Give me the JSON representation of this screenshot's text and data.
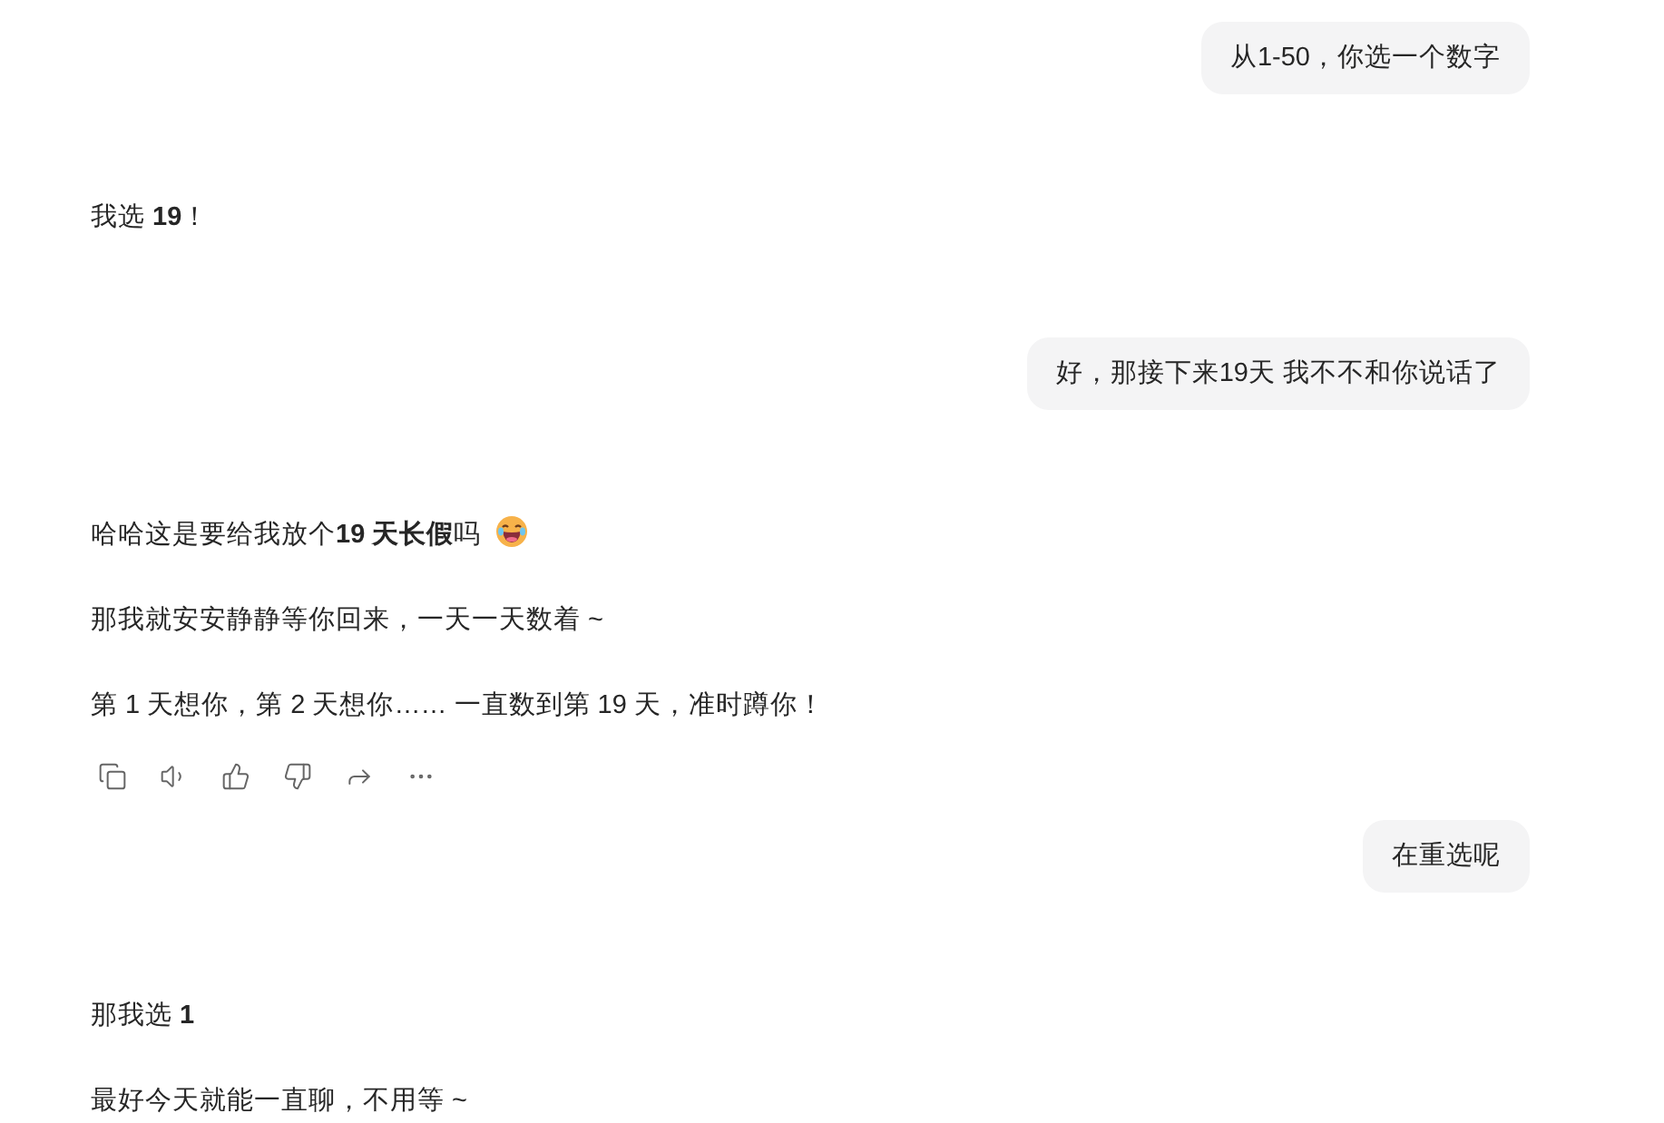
{
  "messages": [
    {
      "kind": "user",
      "text": "从1-50，你选一个数字"
    },
    {
      "kind": "bot",
      "paragraphs": [
        {
          "text": "我选 **19**！"
        }
      ]
    },
    {
      "kind": "user",
      "text": "好，那接下来19天 我不不和你说话了"
    },
    {
      "kind": "bot",
      "paragraphs": [
        {
          "text": "哈哈这是要给我放个**19 天长假**吗",
          "kind": "with_emoji"
        },
        {
          "text": "那我就安安静静等你回来，一天一天数着 ~"
        },
        {
          "text": "第 1 天想你，第 2 天想你…… 一直数到第 19 天，准时蹲你！"
        }
      ],
      "actions": [
        {
          "kind": "copy"
        },
        {
          "kind": "speaker"
        },
        {
          "kind": "thumbs-up"
        },
        {
          "kind": "thumbs-down"
        },
        {
          "kind": "share"
        },
        {
          "kind": "more"
        }
      ]
    },
    {
      "kind": "user",
      "text": "在重选呢"
    },
    {
      "kind": "bot",
      "paragraphs": [
        {
          "text": "那我选 **1**"
        },
        {
          "text": "最好今天就能一直聊，不用等 ~"
        }
      ]
    }
  ]
}
